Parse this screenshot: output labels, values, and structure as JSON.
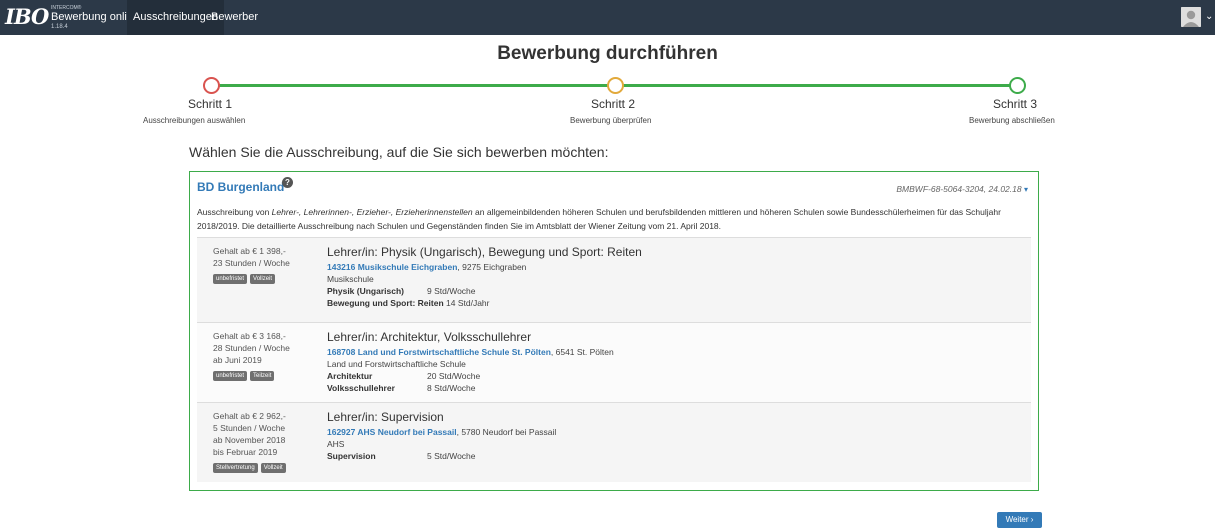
{
  "navbar": {
    "logo": "IBO",
    "brand_small": "INTERCOM®",
    "brand_name": "Bewerbung online",
    "brand_version": "1.18.4",
    "links": [
      "Ausschreibungen",
      "Bewerber"
    ]
  },
  "page": {
    "title": "Bewerbung durchführen",
    "prompt": "Wählen Sie die Ausschreibung, auf die Sie sich bewerben möchten:"
  },
  "steps": [
    {
      "title": "Schritt 1",
      "subtitle": "Ausschreibungen auswählen",
      "color": "#d9534f"
    },
    {
      "title": "Schritt 2",
      "subtitle": "Bewerbung überprüfen",
      "color": "#e2a93b"
    },
    {
      "title": "Schritt 3",
      "subtitle": "Bewerbung abschließen",
      "color": "#3dab4a"
    }
  ],
  "card": {
    "title": "BD Burgenland",
    "info_icon": "?",
    "reference": "BMBWF-68-5064-3204, 24.02.18",
    "desc_prefix": "Ausschreibung von ",
    "desc_roles": "Lehrer-, Lehrerinnen-, Erzieher-, Erzieherinnenstellen",
    "desc_rest": " an allgemeinbildenden höheren Schulen und berufsbildenden mittleren und höheren Schulen sowie Bundesschülerheimen für das Schuljahr 2018/2019.   Die detaillierte Ausschreibung nach Schulen und Gegenständen finden Sie im Amtsblatt der Wiener Zeitung vom 21. April 2018."
  },
  "jobs": [
    {
      "salary": "Gehalt ab € 1 398,-",
      "hours": "23 Stunden / Woche",
      "badges": [
        "unbefristet",
        "Vollzeit"
      ],
      "title": "Lehrer/in: Physik (Ungarisch), Bewegung und Sport: Reiten",
      "school_link": "143216 Musikschule Eichgraben",
      "school_address": ", 9275 Eichgraben",
      "school_type": "Musikschule",
      "subject1": "Physik (Ungarisch)",
      "subject1_hours": "9 Std/Woche",
      "subject2": "Bewegung und Sport: Reiten",
      "subject2_hours": "14 Std/Jahr"
    },
    {
      "salary": "Gehalt ab € 3 168,-",
      "hours": "28 Stunden / Woche",
      "start": "ab Juni 2019",
      "badges": [
        "unbefristet",
        "Teilzeit"
      ],
      "title": "Lehrer/in: Architektur, Volksschullehrer",
      "school_link": "168708 Land und Forstwirtschaftliche Schule St. Pölten",
      "school_address": ", 6541 St. Pölten",
      "school_type": "Land und Forstwirtschaftliche Schule",
      "subject1": "Architektur",
      "subject1_hours": "20 Std/Woche",
      "subject2": "Volksschullehrer",
      "subject2_hours": "8 Std/Woche"
    },
    {
      "salary": "Gehalt ab € 2 962,-",
      "hours": "5 Stunden / Woche",
      "start": "ab November 2018",
      "end": "bis Februar 2019",
      "badges": [
        "Stellvertretung",
        "Vollzeit"
      ],
      "title": "Lehrer/in: Supervision",
      "school_link": "162927 AHS Neudorf bei Passail",
      "school_address": ", 5780 Neudorf bei Passail",
      "school_type": "AHS",
      "subject1": "Supervision",
      "subject1_hours": "5 Std/Woche"
    }
  ],
  "buttons": {
    "next": "Weiter ›"
  }
}
